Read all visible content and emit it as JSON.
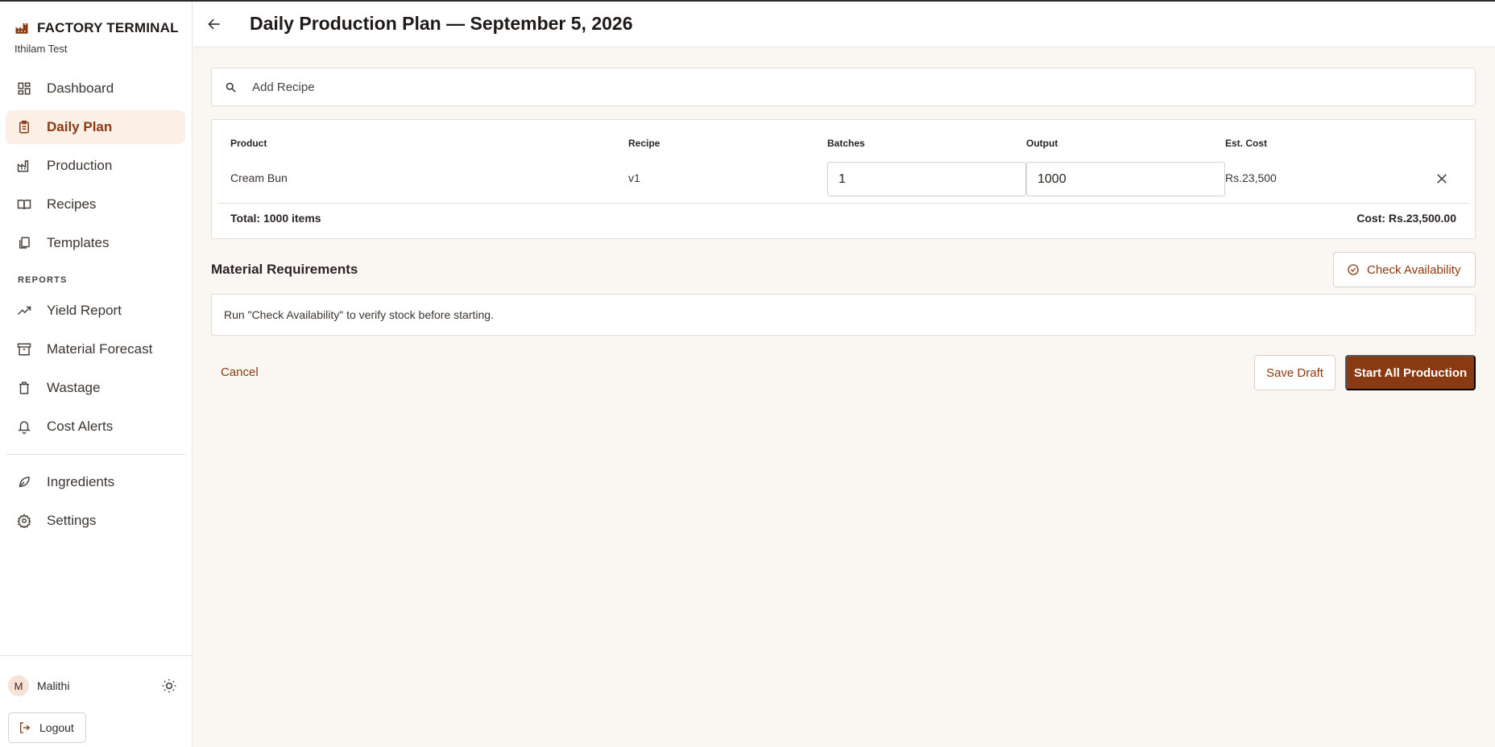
{
  "brand": {
    "title": "FACTORY TERMINAL",
    "subtitle": "Ithilam Test",
    "icon": "factory-icon"
  },
  "sidebar": {
    "items": [
      {
        "label": "Dashboard",
        "icon": "dashboard-icon"
      },
      {
        "label": "Daily Plan",
        "icon": "clipboard-icon",
        "active": true
      },
      {
        "label": "Production",
        "icon": "factory-icon"
      },
      {
        "label": "Recipes",
        "icon": "book-icon"
      },
      {
        "label": "Templates",
        "icon": "copy-icon"
      }
    ],
    "reports_label": "REPORTS",
    "report_items": [
      {
        "label": "Yield Report",
        "icon": "trending-up-icon"
      },
      {
        "label": "Material Forecast",
        "icon": "archive-icon"
      },
      {
        "label": "Wastage",
        "icon": "trash-icon"
      },
      {
        "label": "Cost Alerts",
        "icon": "bell-icon"
      }
    ],
    "other_items": [
      {
        "label": "Ingredients",
        "icon": "leaf-icon"
      },
      {
        "label": "Settings",
        "icon": "gear-icon"
      }
    ],
    "user": {
      "initial": "M",
      "name": "Malithi"
    },
    "logout_label": "Logout"
  },
  "header": {
    "title": "Daily Production Plan — September 5, 2026"
  },
  "search": {
    "placeholder": "Add Recipe"
  },
  "table": {
    "columns": [
      "Product",
      "Recipe",
      "Batches",
      "Output",
      "Est. Cost"
    ],
    "rows": [
      {
        "product": "Cream Bun",
        "recipe": "v1",
        "batches": "1",
        "output": "1000",
        "cost": "Rs.23,500"
      }
    ],
    "total_items": "Total: 1000 items",
    "total_cost": "Cost: Rs.23,500.00"
  },
  "materials": {
    "title": "Material Requirements",
    "check_label": "Check Availability",
    "info": "Run \"Check Availability\" to verify stock before starting."
  },
  "actions": {
    "cancel": "Cancel",
    "save": "Save Draft",
    "start": "Start All Production"
  },
  "colors": {
    "accent": "#8a3a12",
    "background": "#faf6f2",
    "active_bg": "#fbefe6"
  }
}
